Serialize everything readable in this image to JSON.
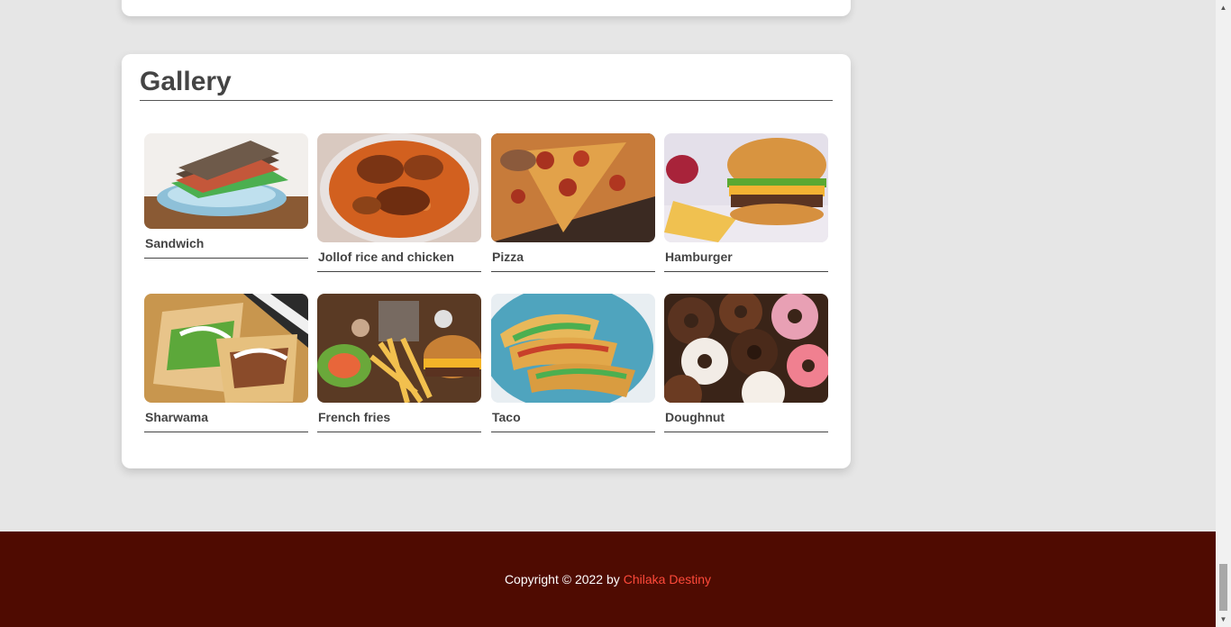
{
  "gallery": {
    "title": "Gallery",
    "items": [
      {
        "caption": "Sandwich",
        "icon": "sandwich-image"
      },
      {
        "caption": "Jollof rice and chicken",
        "icon": "jollof-rice-image"
      },
      {
        "caption": "Pizza",
        "icon": "pizza-image"
      },
      {
        "caption": "Hamburger",
        "icon": "hamburger-image"
      },
      {
        "caption": "Sharwama",
        "icon": "sharwama-image"
      },
      {
        "caption": "French fries",
        "icon": "french-fries-image"
      },
      {
        "caption": "Taco",
        "icon": "taco-image"
      },
      {
        "caption": "Doughnut",
        "icon": "doughnut-image"
      }
    ]
  },
  "footer": {
    "copyright_text": "Copyright © 2022 by",
    "author": "Chilaka Destiny",
    "author_color": "#ff4a3a",
    "background_color": "#4f0b01"
  },
  "scrollbar": {
    "up_arrow": "▲",
    "down_arrow": "▼"
  }
}
